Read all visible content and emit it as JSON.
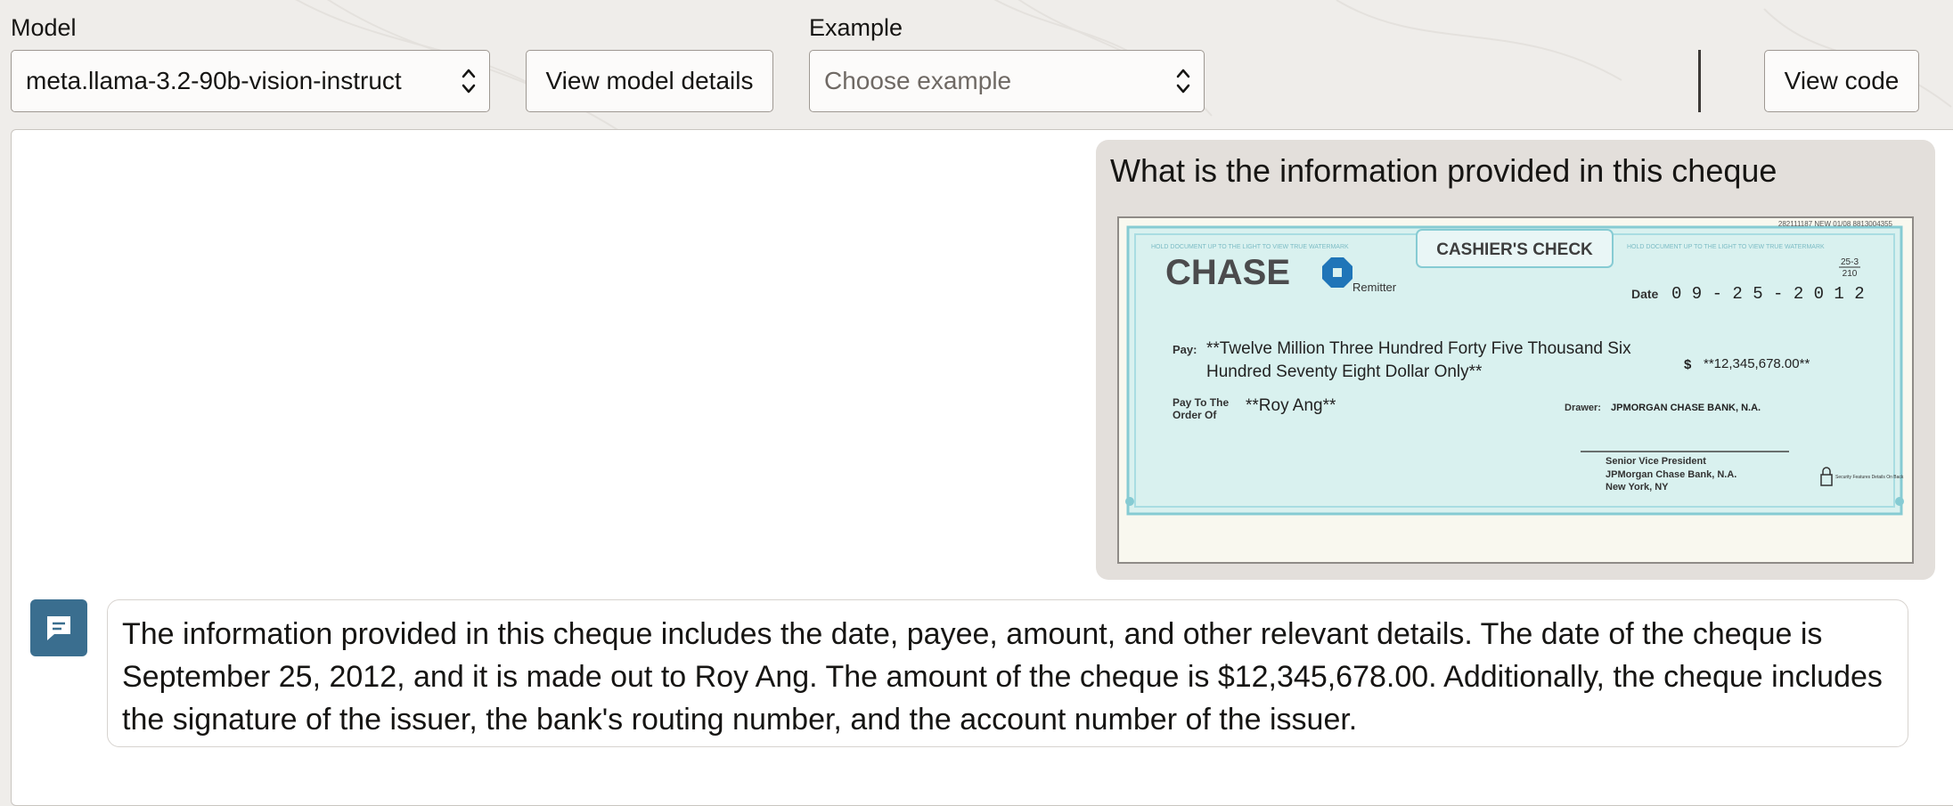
{
  "header": {
    "model_label": "Model",
    "model_value": "meta.llama-3.2-90b-vision-instruct",
    "view_model_details_label": "View model details",
    "example_label": "Example",
    "example_placeholder": "Choose example",
    "view_code_label": "View code"
  },
  "chat": {
    "user_message": "What is the information provided in this cheque",
    "assistant_message": "The information provided in this cheque includes the date, payee, amount, and other relevant details. The date of the cheque is September 25, 2012, and it is made out to Roy Ang. The amount of the cheque is $12,345,678.00. Additionally, the cheque includes the signature of the issuer, the bank's routing number, and the account number of the issuer."
  },
  "cheque": {
    "serial": "282111187 NEW 01/08 8813004355",
    "title": "CASHIER'S CHECK",
    "bank_logo_text": "CHASE",
    "remitter_label": "Remitter",
    "fraction_top": "25-3",
    "fraction_bottom": "210",
    "date_label": "Date",
    "date_value": "0 9 - 2 5 - 2 0 1 2",
    "pay_label": "Pay:",
    "amount_words_line1": "**Twelve Million Three Hundred Forty Five Thousand Six",
    "amount_words_line2": "Hundred Seventy Eight Dollar Only**",
    "dollar_sign": "$",
    "amount_numeric": "**12,345,678.00**",
    "pay_to_label_1": "Pay To The",
    "pay_to_label_2": "Order Of",
    "payee": "**Roy Ang**",
    "drawer_label": "Drawer:",
    "drawer_value": "JPMORGAN CHASE BANK, N.A.",
    "signer_title": "Senior Vice President",
    "signer_bank": "JPMorgan Chase Bank, N.A.",
    "signer_city": "New York, NY",
    "security_text": "Security Features Details On Back",
    "border_text": "HOLD DOCUMENT UP TO THE LIGHT TO VIEW TRUE WATERMARK",
    "colors": {
      "cheque_bg": "#d9f1ef",
      "cheque_border": "#86cbd3",
      "logo": "#4b4b4d",
      "logo_octagon": "#1f75b8"
    }
  },
  "colors": {
    "accent": "#3a6e8f",
    "user_bubble": "#e3dfdb",
    "page_bg": "#efedea"
  },
  "icons": {
    "select_chevron": "chevron-up-down-icon",
    "assistant_avatar": "chat-bubble-icon"
  }
}
